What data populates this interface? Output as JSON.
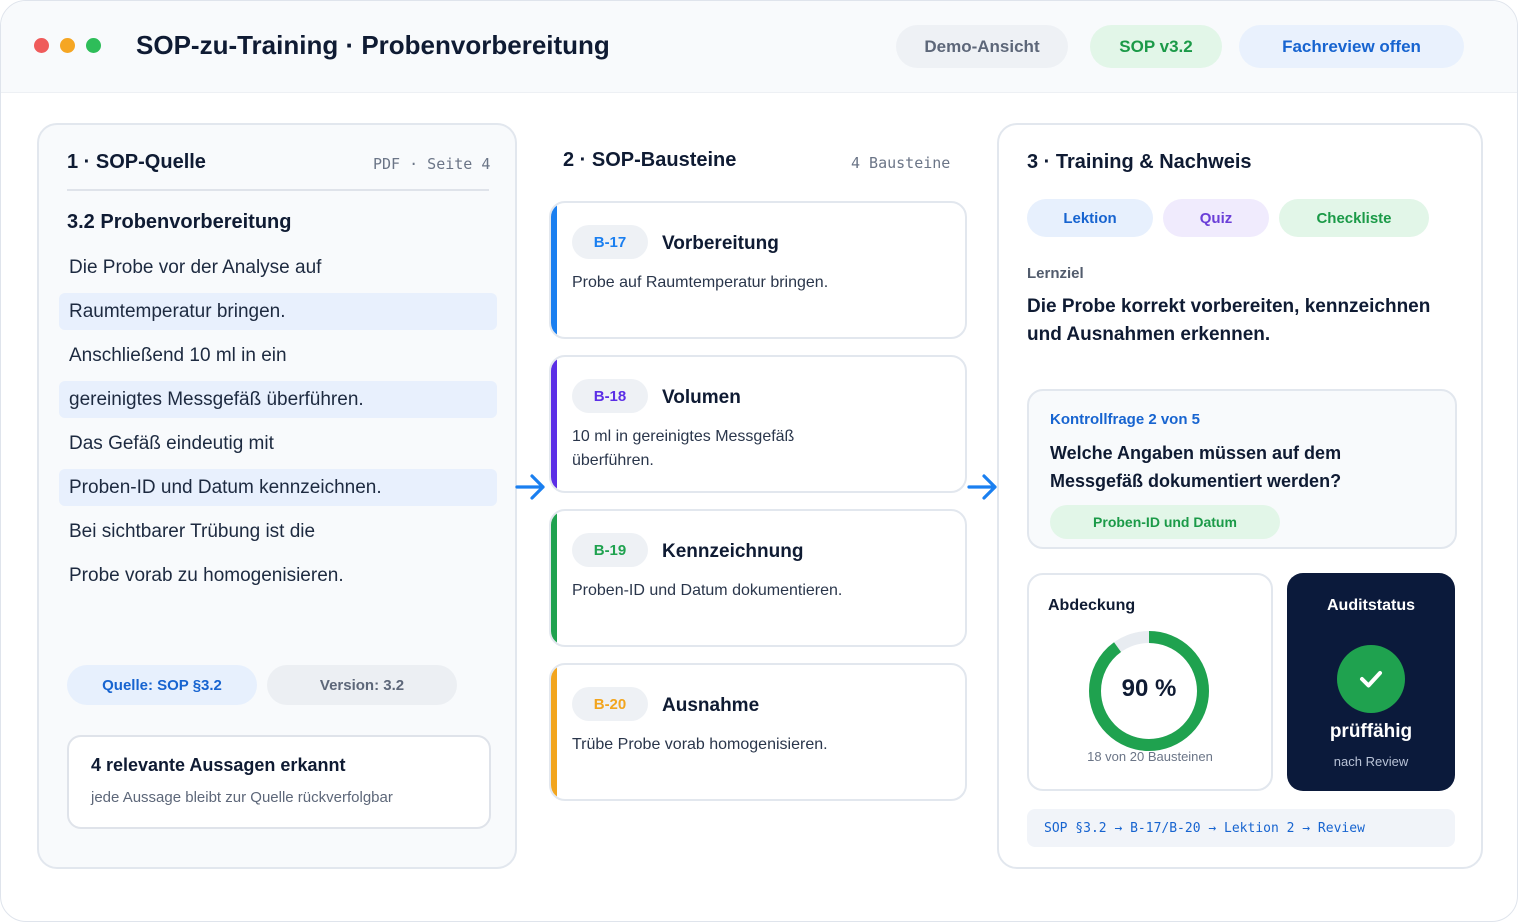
{
  "window": {
    "title": "SOP-zu-Training · Probenvorbereitung",
    "badges": {
      "demo": "Demo-Ansicht",
      "sop_version": "SOP v3.2",
      "review": "Fachreview offen"
    }
  },
  "source": {
    "title": "1 · SOP-Quelle",
    "meta": "PDF · Seite 4",
    "heading": "3.2 Probenvorbereitung",
    "lines": [
      "Die Probe vor der Analyse auf",
      "Raumtemperatur bringen.",
      "Anschließend 10 ml in ein",
      "gereinigtes Messgefäß überführen.",
      "Das Gefäß eindeutig mit",
      "Proben-ID und Datum kennzeichnen.",
      "Bei sichtbarer Trübung ist die",
      "Probe vorab zu homogenisieren."
    ],
    "tag_source": "Quelle: SOP §3.2",
    "tag_version": "Version: 3.2",
    "summary_title": "4 relevante Aussagen erkannt",
    "summary_sub": "jede Aussage bleibt zur Quelle rückverfolgbar"
  },
  "blocks": {
    "title": "2 · SOP-Bausteine",
    "meta": "4 Bausteine",
    "items": [
      {
        "id": "B-17",
        "name": "Vorbereitung",
        "desc": "Probe auf Raumtemperatur bringen.",
        "color": "#1a7ff0"
      },
      {
        "id": "B-18",
        "name": "Volumen",
        "desc": "10 ml in gereinigtes Messgefäß überführen.",
        "color": "#5b2ee6"
      },
      {
        "id": "B-19",
        "name": "Kennzeichnung",
        "desc": "Proben-ID und Datum dokumentieren.",
        "color": "#1fa24f"
      },
      {
        "id": "B-20",
        "name": "Ausnahme",
        "desc": "Trübe Probe vorab homogenisieren.",
        "color": "#f2a51e"
      }
    ]
  },
  "training": {
    "title": "3 · Training & Nachweis",
    "tabs": {
      "lesson": "Lektion",
      "quiz": "Quiz",
      "checklist": "Checkliste"
    },
    "objective_label": "Lernziel",
    "objective": "Die Probe korrekt vorbereiten, kennzeichnen und Ausnahmen erkennen.",
    "question_label": "Kontrollfrage 2 von 5",
    "question": "Welche Angaben müssen auf dem Messgefäß dokumentiert werden?",
    "answer": "Proben-ID und Datum",
    "coverage_title": "Abdeckung",
    "coverage_percent": 90,
    "coverage_label": "90 %",
    "coverage_sub": "18 von 20 Bausteinen",
    "audit_title": "Auditstatus",
    "audit_status": "prüffähig",
    "audit_sub": "nach Review",
    "trace": "SOP §3.2 → B-17/B-20 → Lektion 2 → Review"
  }
}
